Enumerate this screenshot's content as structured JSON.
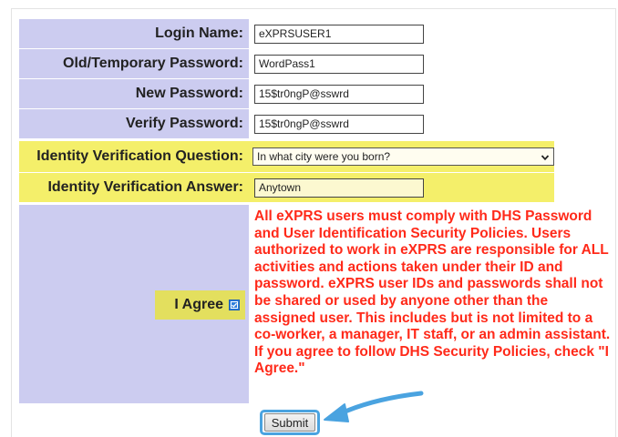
{
  "form": {
    "login_name": {
      "label": "Login Name:",
      "value": "eXPRSUSER1"
    },
    "old_password": {
      "label": "Old/Temporary Password:",
      "value": "WordPass1"
    },
    "new_password": {
      "label": "New Password:",
      "value": "15$tr0ngP@sswrd"
    },
    "verify_password": {
      "label": "Verify Password:",
      "value": "15$tr0ngP@sswrd"
    },
    "identity_question": {
      "label": "Identity Verification Question:",
      "selected": "In what city were you born?"
    },
    "identity_answer": {
      "label": "Identity Verification Answer:",
      "value": "Anytown"
    },
    "agree": {
      "label": "I Agree",
      "checked": true
    },
    "policy_text": "All eXPRS users must comply with DHS Password and User Identification Security Policies. Users authorized to work in eXPRS are responsible for ALL activities and actions taken under their ID and password. eXPRS user IDs and passwords shall not be shared or used by anyone other than the assigned user. This includes but is not limited to a co-worker, a manager, IT staff, or an admin assistant. If you agree to follow DHS Security Policies, check \"I Agree.\"",
    "submit_label": "Submit"
  },
  "colors": {
    "label_background": "#ccccf0",
    "highlight": "#f4ef6a",
    "policy_text": "#ff2a1a",
    "annotation_arrow": "#4aa3e0"
  },
  "icons": {
    "select_chevron": "chevron-down-icon",
    "agree_checkbox": "checkmark-icon",
    "annotation": "arrow-icon"
  }
}
